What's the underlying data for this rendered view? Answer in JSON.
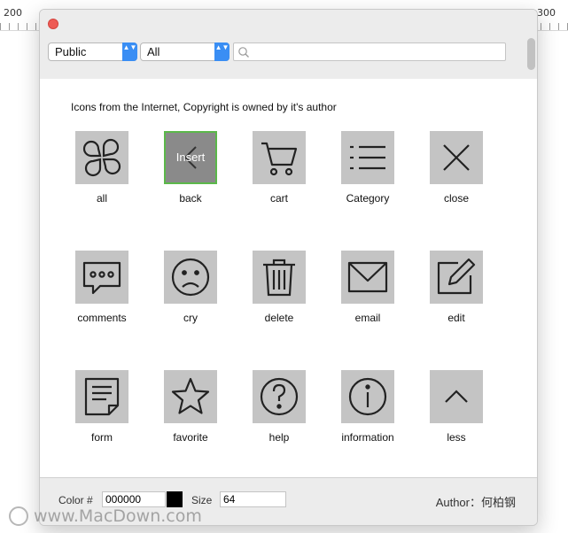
{
  "ruler": {
    "left_number": "200",
    "right_number": "300"
  },
  "toolbar": {
    "scope_select": "Public",
    "category_select": "All",
    "search_value": "",
    "select_arrow_glyph": "▲▼"
  },
  "notice": "Icons from the Internet, Copyright is owned by it's author",
  "icons": [
    {
      "label": "all",
      "icon": "flower-icon"
    },
    {
      "label": "back",
      "icon": "back-icon",
      "overlay": "Insert"
    },
    {
      "label": "cart",
      "icon": "cart-icon"
    },
    {
      "label": "Category",
      "icon": "list-icon"
    },
    {
      "label": "close",
      "icon": "close-icon"
    },
    {
      "label": "comments",
      "icon": "comments-icon"
    },
    {
      "label": "cry",
      "icon": "sad-face-icon"
    },
    {
      "label": "delete",
      "icon": "trash-icon"
    },
    {
      "label": "email",
      "icon": "envelope-icon"
    },
    {
      "label": "edit",
      "icon": "edit-icon"
    },
    {
      "label": "form",
      "icon": "form-icon"
    },
    {
      "label": "favorite",
      "icon": "star-icon"
    },
    {
      "label": "help",
      "icon": "question-icon"
    },
    {
      "label": "information",
      "icon": "info-icon"
    },
    {
      "label": "less",
      "icon": "chevron-up-icon"
    }
  ],
  "footer": {
    "color_label": "Color #",
    "color_value": "000000",
    "swatch_color": "#000000",
    "size_label": "Size",
    "size_value": "64",
    "author": "Author：何柏钢"
  },
  "colors": {
    "selected_border": "#5bb84a",
    "tile_bg": "#c4c4c4",
    "accent": "#3a8ef4",
    "close_dot": "#ee5b55"
  },
  "watermark": "www.MacDown.com"
}
